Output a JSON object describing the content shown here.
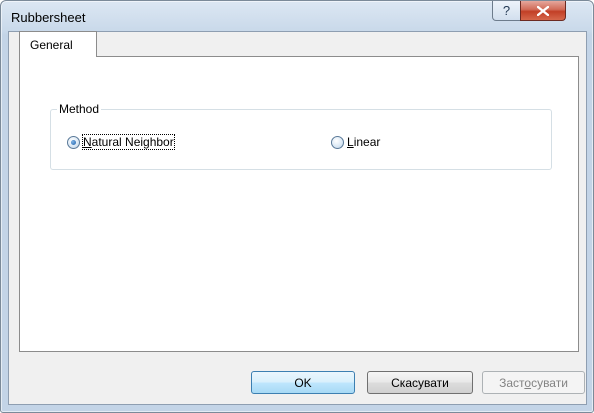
{
  "window": {
    "title": "Rubbersheet",
    "help_glyph": "?",
    "close_glyph": "x"
  },
  "tabs": [
    {
      "label": "General",
      "selected": true
    }
  ],
  "method_group": {
    "label": "Method",
    "options": [
      {
        "label_prefix": "",
        "label_mnemonic": "N",
        "label_rest": "atural Neighbor",
        "selected": true
      },
      {
        "label_prefix": "",
        "label_mnemonic": "L",
        "label_rest": "inear",
        "selected": false
      }
    ]
  },
  "buttons": {
    "ok": "OK",
    "cancel": "Скасувати",
    "apply_prefix": "Заст",
    "apply_mnemonic": "о",
    "apply_rest": "сувати"
  },
  "colors": {
    "accent": "#3c7fb1",
    "close": "#c23f26"
  }
}
